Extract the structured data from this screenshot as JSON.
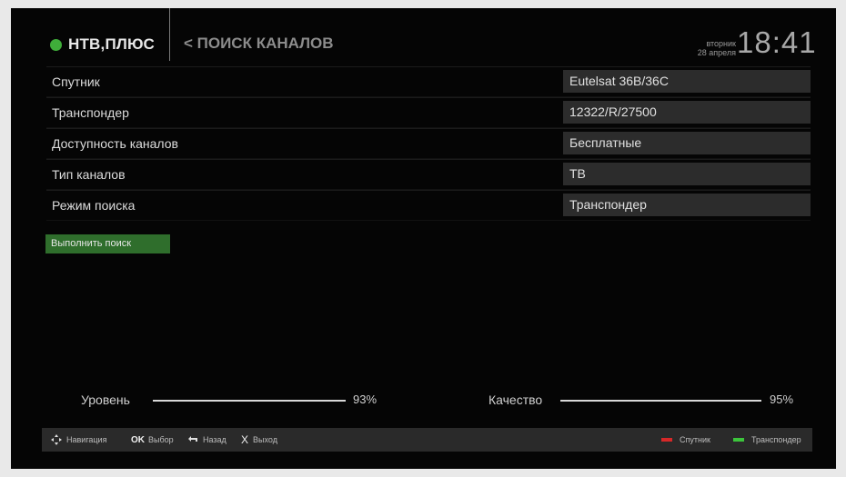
{
  "header": {
    "logo_text": "НТВ,ПЛЮС",
    "title": "< ПОИСК КАНАЛОВ",
    "weekday": "вторник",
    "date": "28 апреля",
    "time": "18:41"
  },
  "settings": [
    {
      "label": "Спутник",
      "value": "Eutelsat 36B/36C"
    },
    {
      "label": "Транспондер",
      "value": "12322/R/27500"
    },
    {
      "label": "Доступность каналов",
      "value": "Бесплатные"
    },
    {
      "label": "Тип каналов",
      "value": "ТВ"
    },
    {
      "label": "Режим поиска",
      "value": "Транспондер"
    }
  ],
  "search_button": "Выполнить поиск",
  "signal": {
    "level_label": "Уровень",
    "level_value": "93%",
    "level": 93,
    "quality_label": "Качество",
    "quality_value": "95%",
    "quality": 95
  },
  "bottom_bar": {
    "navigation": "Навигация",
    "ok_key": "OK",
    "ok_label": "Выбор",
    "back_label": "Назад",
    "exit_key": "X",
    "exit_label": "Выход",
    "red_label": "Спутник",
    "green_label": "Транспондер"
  },
  "colors": {
    "brand_green": "#3fae3a",
    "button_green": "#2f6e2c",
    "red_key": "#d62828",
    "green_key": "#3cc43c"
  }
}
